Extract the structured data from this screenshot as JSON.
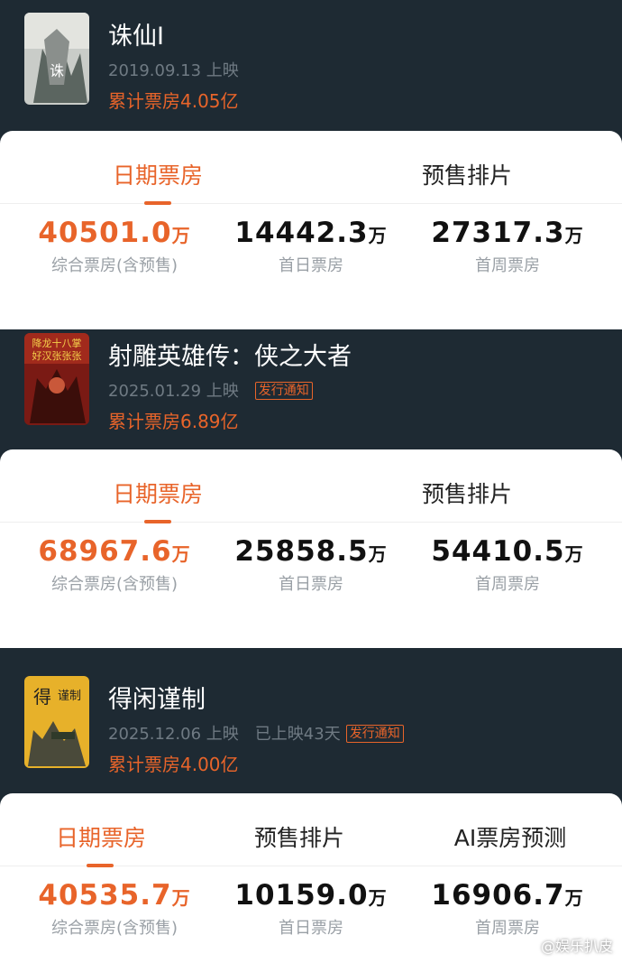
{
  "movies": [
    {
      "title": "诛仙Ⅰ",
      "release": "2019.09.13 上映",
      "running": "",
      "notice": "",
      "total": "累计票房4.05亿",
      "tabs": [
        "日期票房",
        "预售排片"
      ],
      "stats": [
        {
          "value": "40501.0",
          "unit": "万",
          "label": "综合票房(含预售)"
        },
        {
          "value": "14442.3",
          "unit": "万",
          "label": "首日票房"
        },
        {
          "value": "27317.3",
          "unit": "万",
          "label": "首周票房"
        }
      ]
    },
    {
      "title": "射雕英雄传：侠之大者",
      "release": "2025.01.29 上映",
      "running": "",
      "notice": "发行通知",
      "total": "累计票房6.89亿",
      "tabs": [
        "日期票房",
        "预售排片"
      ],
      "stats": [
        {
          "value": "68967.6",
          "unit": "万",
          "label": "综合票房(含预售)"
        },
        {
          "value": "25858.5",
          "unit": "万",
          "label": "首日票房"
        },
        {
          "value": "54410.5",
          "unit": "万",
          "label": "首周票房"
        }
      ]
    },
    {
      "title": "得闲谨制",
      "release": "2025.12.06 上映",
      "running": "已上映43天",
      "notice": "发行通知",
      "total": "累计票房4.00亿",
      "tabs": [
        "日期票房",
        "预售排片",
        "AI票房预测"
      ],
      "stats": [
        {
          "value": "40535.7",
          "unit": "万",
          "label": "综合票房(含预售)"
        },
        {
          "value": "10159.0",
          "unit": "万",
          "label": "首日票房"
        },
        {
          "value": "16906.7",
          "unit": "万",
          "label": "首周票房"
        }
      ]
    }
  ],
  "watermark": "@娱乐扒皮",
  "colors": {
    "accent": "#e8642a",
    "dark_bg": "#1e2a33"
  }
}
